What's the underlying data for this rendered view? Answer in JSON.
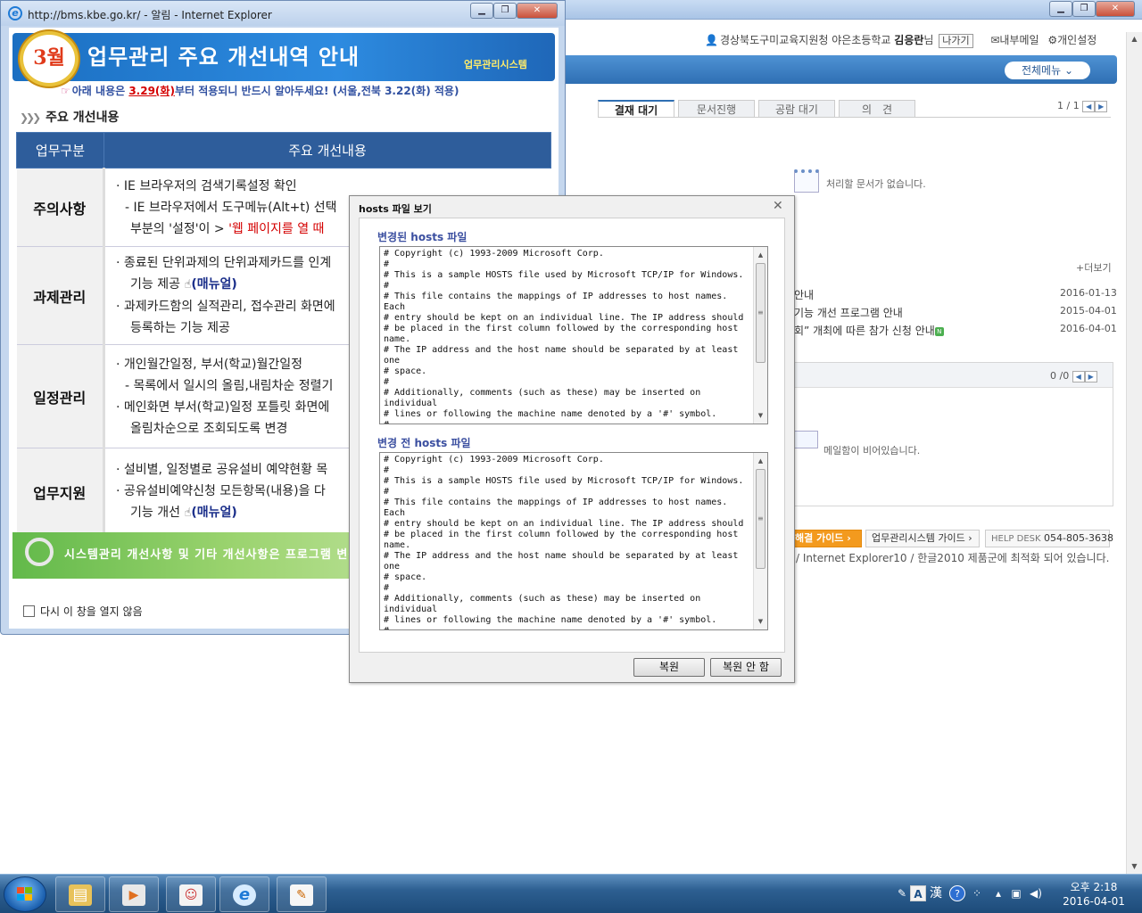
{
  "background": {
    "user": {
      "org": "경상북도구미교육지원청 야은초등학교",
      "name": "김응란",
      "suffix": "님",
      "logout": "나가기",
      "internal_mail": "내부메일",
      "settings": "개인설정"
    },
    "all_menu": "전체메뉴",
    "approval": {
      "tabs": [
        "결재 대기",
        "문서진행",
        "공람 대기",
        "의　견"
      ],
      "page": "1 / 1",
      "empty": "처리할 문서가 없습니다."
    },
    "notices": {
      "more": "+더보기",
      "items": [
        {
          "title": "안내",
          "date": "2016-01-13"
        },
        {
          "title": "기능 개선 프로그램 안내",
          "date": "2015-04-01"
        },
        {
          "title": "회” 개최에 따른 참가 신청 안내",
          "date": "2016-04-01",
          "badge": "N"
        }
      ]
    },
    "mail": {
      "page": "0 /0",
      "empty": "메일함이 비어있습니다."
    },
    "guides": {
      "guide1": "해결 가이드",
      "guide2": "업무관리시스템 가이드",
      "helpdesk_label": "HELP DESK",
      "helpdesk_number": "054-805-3638"
    },
    "footer_note": "/ Internet Explorer10 / 한글2010 제품군에 최적화 되어 있습니다."
  },
  "popup": {
    "window_title": "http://bms.kbe.go.kr/ - 알림 - Internet Explorer",
    "banner": {
      "month": "3월",
      "title": "업무관리 주요 개선내역 안내",
      "subtitle": "업무관리시스템"
    },
    "notice": {
      "prefix": "아래 내용은 ",
      "date": "3.29(화)",
      "suffix": "부터 적용되니 반드시 알아두세요! (서울,전북 3.22(화) 적용)"
    },
    "section_title": "주요 개선내용",
    "table": {
      "headers": [
        "업무구분",
        "주요 개선내용"
      ],
      "rows": [
        {
          "category": "주의사항",
          "lines": [
            "· IE 브라우저의 검색기록설정 확인",
            "- IE 브라우저에서 도구메뉴(Alt+t) 선택",
            "부분의 '설정'이 > ",
            "'웹 페이지를 열 때"
          ]
        },
        {
          "category": "과제관리",
          "lines": [
            "· 종료된 단위과제의 단위과제카드를 인계",
            "기능 제공",
            "(매뉴얼)",
            "· 과제카드함의 실적관리, 접수관리 화면에",
            "등록하는 기능 제공"
          ]
        },
        {
          "category": "일정관리",
          "lines": [
            "· 개인월간일정, 부서(학교)월간일정",
            "- 목록에서 일시의 올림,내림차순 정렬기",
            "· 메인화면 부서(학교)일정 포틀릿 화면에",
            "올림차순으로 조회되도록 변경"
          ]
        },
        {
          "category": "업무지원",
          "lines": [
            "· 설비별, 일정별로 공유설비 예약현황 목",
            "· 공유설비예약신청 모든항목(내용)을 다",
            "기능 개선",
            "(매뉴얼)"
          ]
        }
      ]
    },
    "footer_banner": "시스템관리 개선사항 및 기타 개선사항은 프로그램 변경",
    "dont_open": "다시 이 창을 열지 않음"
  },
  "hosts_dialog": {
    "title": "hosts 파일 보기",
    "changed_label": "변경된 hosts 파일",
    "original_label": "변경 전 hosts 파일",
    "file_text": "# Copyright (c) 1993-2009 Microsoft Corp.\n#\n# This is a sample HOSTS file used by Microsoft TCP/IP for Windows.\n#\n# This file contains the mappings of IP addresses to host names. Each\n# entry should be kept on an individual line. The IP address should\n# be placed in the first column followed by the corresponding host name.\n# The IP address and the host name should be separated by at least one\n# space.\n#\n# Additionally, comments (such as these) may be inserted on individual\n# lines or following the machine name denoted by a '#' symbol.\n#\n# For example:\n#",
    "restore": "복원",
    "no_restore": "복원 안 함"
  },
  "taskbar": {
    "ime_a": "A",
    "ime_han": "漢",
    "clock_time": "오후 2:18",
    "clock_date": "2016-04-01"
  }
}
